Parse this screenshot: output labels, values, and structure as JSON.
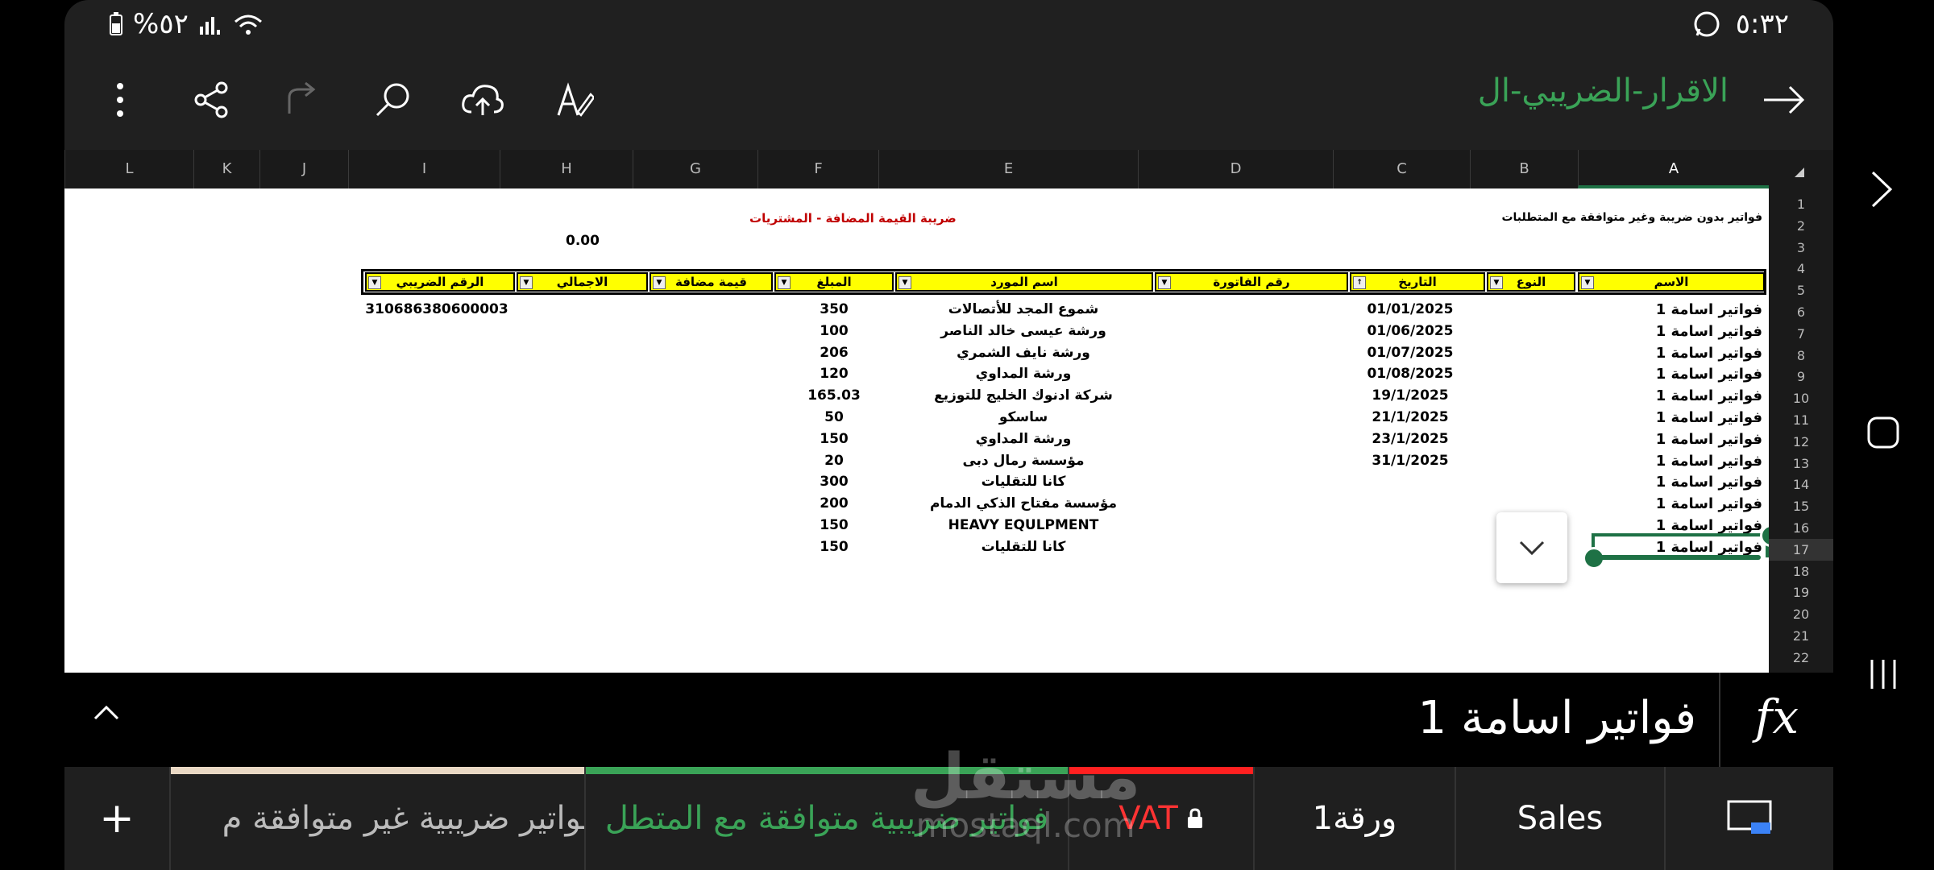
{
  "status": {
    "time": "٥:٣٢",
    "battery": "%٥٢"
  },
  "app": {
    "title": "الاقرار-الضريبي-ال"
  },
  "columns": [
    "A",
    "B",
    "C",
    "D",
    "E",
    "F",
    "G",
    "H",
    "I",
    "J",
    "K",
    "L"
  ],
  "rows": [
    "1",
    "2",
    "3",
    "4",
    "5",
    "6",
    "7",
    "8",
    "9",
    "10",
    "11",
    "12",
    "13",
    "14",
    "15",
    "16",
    "17",
    "18",
    "19",
    "20",
    "21",
    "22"
  ],
  "sheet": {
    "top_right_note": "فواتير بدون ضريبة وغير متوافقة مع المتطلبات",
    "title": "ضريبة القيمة المضافة - المشتريات",
    "total": "0.00",
    "headers": {
      "name": "الاسم",
      "type": "النوع",
      "date": "التاريخ",
      "invoice": "رقم الفاتورة",
      "supplier": "اسم المورد",
      "amount": "المبلغ",
      "vat": "قيمة مضافة",
      "total": "الاجمالي",
      "tax_no": "الرقم الضريبي"
    },
    "data": [
      {
        "name": "فواتير اسامة 1",
        "date": "01/01/2025",
        "supplier": "شموع المجد للأتصالات",
        "amount": "350",
        "tax_no": "310686380600003"
      },
      {
        "name": "فواتير اسامة 1",
        "date": "01/06/2025",
        "supplier": "ورشة عيسى خالد الناصر",
        "amount": "100",
        "tax_no": ""
      },
      {
        "name": "فواتير اسامة 1",
        "date": "01/07/2025",
        "supplier": "ورشة نايف الشمري",
        "amount": "206",
        "tax_no": ""
      },
      {
        "name": "فواتير اسامة 1",
        "date": "01/08/2025",
        "supplier": "ورشة المداوي",
        "amount": "120",
        "tax_no": ""
      },
      {
        "name": "فواتير اسامة 1",
        "date": "19/1/2025",
        "supplier": "شركة ادنوك الخليج للتوزيع",
        "amount": "165.03",
        "tax_no": ""
      },
      {
        "name": "فواتير اسامة 1",
        "date": "21/1/2025",
        "supplier": "ساسكو",
        "amount": "50",
        "tax_no": ""
      },
      {
        "name": "فواتير اسامة 1",
        "date": "23/1/2025",
        "supplier": "ورشة المداوي",
        "amount": "150",
        "tax_no": ""
      },
      {
        "name": "فواتير اسامة 1",
        "date": "31/1/2025",
        "supplier": "مؤسسة رمال دبى",
        "amount": "20",
        "tax_no": ""
      },
      {
        "name": "فواتير اسامة 1",
        "date": "",
        "supplier": "كانا للتقليات",
        "amount": "300",
        "tax_no": ""
      },
      {
        "name": "فواتير اسامة 1",
        "date": "",
        "supplier": "مؤسسة مفتاح الذكي الدمام",
        "amount": "200",
        "tax_no": ""
      },
      {
        "name": "فواتير اسامة 1",
        "date": "",
        "supplier": "HEAVY EQULPMENT",
        "amount": "150",
        "tax_no": ""
      },
      {
        "name": "فواتير اسامة 1",
        "date": "",
        "supplier": "كانا للتقليات",
        "amount": "150",
        "tax_no": ""
      }
    ]
  },
  "formula": {
    "value": "فواتير اسامة 1",
    "fx": "fx"
  },
  "tabs": [
    {
      "label": "+"
    },
    {
      "label": "فواتير ضريبية غير متوافقة م"
    },
    {
      "label": "فواتير ضريبية متوافقة مع المتطل"
    },
    {
      "label": "VAT"
    },
    {
      "label": "ورقة1"
    },
    {
      "label": "Sales"
    }
  ],
  "watermark": {
    "line1": "مستقل",
    "line2": "mostaql.com"
  },
  "colors": {
    "accent": "#3aa357",
    "selection": "#1e7145",
    "header_fill": "#ffff00",
    "title_red": "#c00000"
  }
}
